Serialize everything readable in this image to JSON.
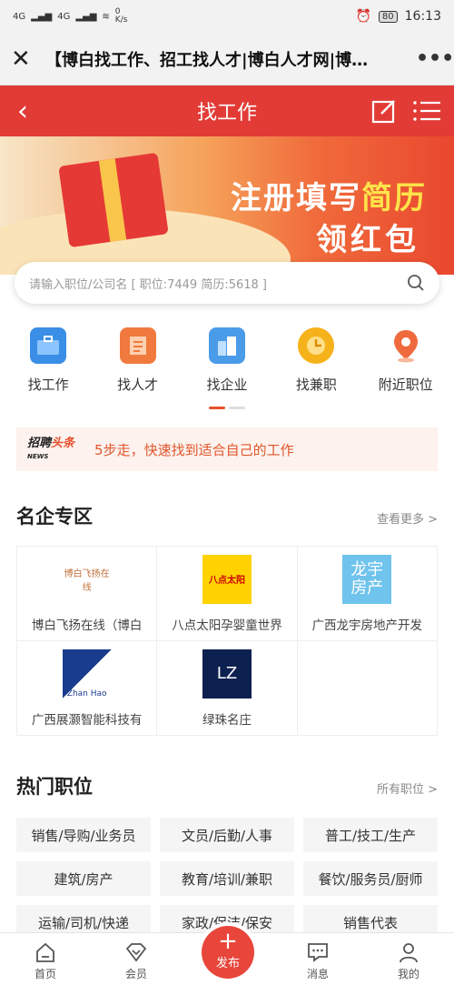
{
  "statusbar": {
    "net1": "4G",
    "net2": "4G",
    "speed": "0",
    "speed_unit": "K/s",
    "battery": "80",
    "time": "16:13"
  },
  "browser": {
    "title": "【博白找工作、招工找人才|博白人才网|博…"
  },
  "header": {
    "title": "找工作"
  },
  "banner": {
    "line1_part1": "注册填写",
    "line1_part2": "简历",
    "line2": "领红包"
  },
  "search": {
    "placeholder": "请输入职位/公司名",
    "stats": "[ 职位:7449  简历:5618 ]"
  },
  "quick": [
    {
      "label": "找工作",
      "color": "#3a8ee6"
    },
    {
      "label": "找人才",
      "color": "#f07a3e"
    },
    {
      "label": "找企业",
      "color": "#4a9be8"
    },
    {
      "label": "找兼职",
      "color": "#f5b21a"
    },
    {
      "label": "附近职位",
      "color": "#ef6a3d"
    }
  ],
  "news": {
    "logo_top": "招聘",
    "logo_sub": "NEWS",
    "logo_b": "头条",
    "text": "5步走，快速找到适合自己的工作"
  },
  "famous": {
    "title": "名企专区",
    "more": "查看更多 >",
    "companies": [
      {
        "name": "博白飞扬在线（博白",
        "logo": "博白飞扬在线"
      },
      {
        "name": "八点太阳孕婴童世界",
        "logo": "八点太阳"
      },
      {
        "name": "广西龙宇房地产开发",
        "logo": "龙宇\n房产"
      },
      {
        "name": "广西展灏智能科技有",
        "logo": "Zhan Hao"
      },
      {
        "name": "绿珠名庄",
        "logo": "LZ"
      }
    ]
  },
  "hot": {
    "title": "热门职位",
    "more": "所有职位 >",
    "jobs": [
      "销售/导购/业务员",
      "文员/后勤/人事",
      "普工/技工/生产",
      "建筑/房产",
      "教育/培训/兼职",
      "餐饮/服务员/厨师",
      "运输/司机/快递",
      "家政/保洁/保安",
      "销售代表"
    ]
  },
  "nav": {
    "home": "首页",
    "member": "会员",
    "publish": "发布",
    "message": "消息",
    "mine": "我的"
  }
}
